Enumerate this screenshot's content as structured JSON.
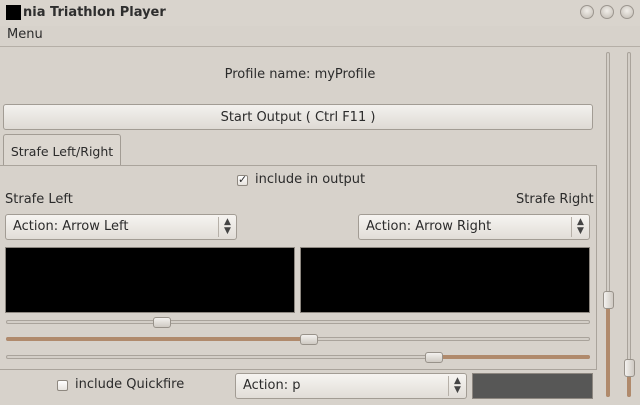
{
  "window": {
    "title": "nia Triathlon Player",
    "menu_label": "Menu"
  },
  "profile": {
    "text": "Profile name: myProfile"
  },
  "start_button": {
    "label": "Start Output ( Ctrl F11 )"
  },
  "tabs": [
    {
      "label": "Strafe Left/Right",
      "selected": true
    }
  ],
  "panel": {
    "include_in_output_label": "include in output",
    "include_in_output_checked": true,
    "left_label": "Strafe Left",
    "right_label": "Strafe Right",
    "left_action": "Action: Arrow Left",
    "right_action": "Action: Arrow Right"
  },
  "sliders": {
    "slider1_fraction": 0.26,
    "slider2_fraction": 0.52,
    "slider3_fraction": 0.74
  },
  "vertical_sliders": {
    "left_fraction": 0.27,
    "right_fraction": 0.06
  },
  "bottom": {
    "quickfire_label": "include Quickfire",
    "quickfire_checked": false,
    "quickfire_action": "Action: p"
  },
  "colors": {
    "accent_fill": "#b08a6c",
    "window_bg": "#d7d2cb",
    "display_bg": "#000000",
    "swatch": "#575756"
  }
}
